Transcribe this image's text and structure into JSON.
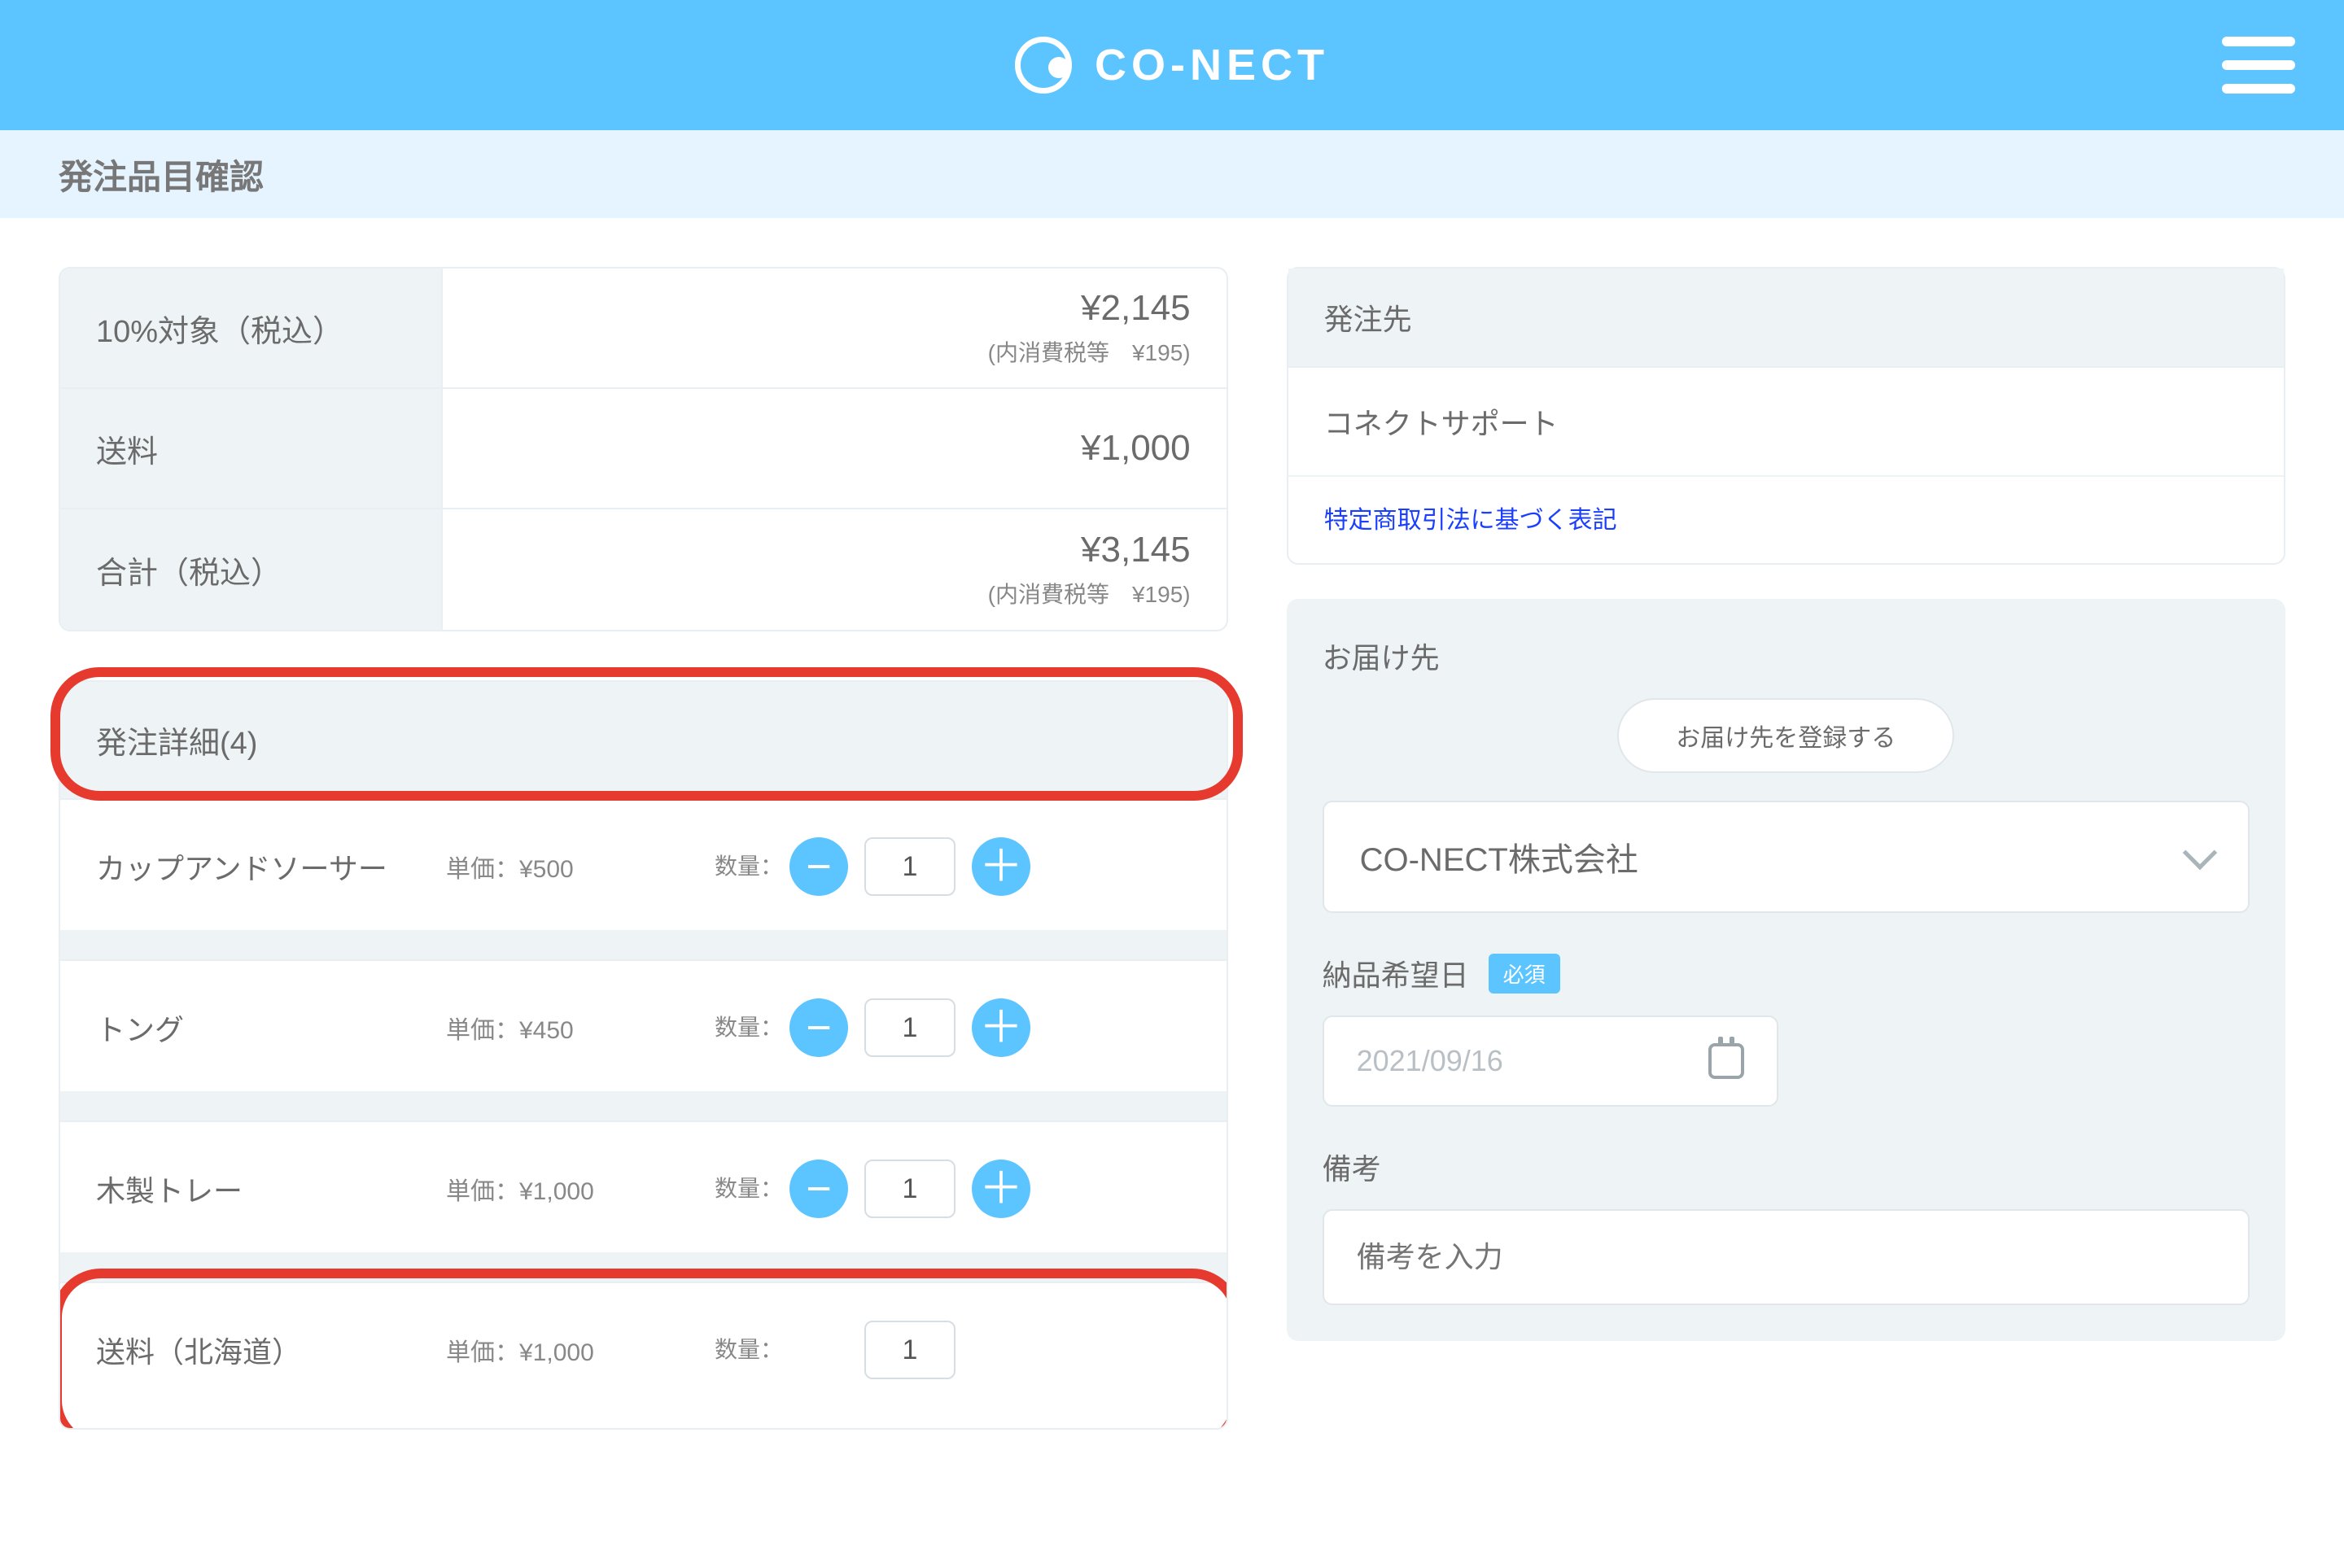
{
  "header": {
    "brand": "CO-NECT"
  },
  "subheader": {
    "title": "発注品目確認"
  },
  "summary": {
    "rows": [
      {
        "label": "10%対象（税込）",
        "amount": "¥2,145",
        "sub": "(内消費税等　¥195)"
      },
      {
        "label": "送料",
        "amount": "¥1,000",
        "sub": ""
      },
      {
        "label": "合計（税込）",
        "amount": "¥3,145",
        "sub": "(内消費税等　¥195)"
      }
    ]
  },
  "details": {
    "title": "発注詳細(4)",
    "qty_label": "数量：",
    "items": [
      {
        "name": "カップアンドソーサー",
        "unit": "単価：¥500",
        "qty": "1"
      },
      {
        "name": "トング",
        "unit": "単価：¥450",
        "qty": "1"
      },
      {
        "name": "木製トレー",
        "unit": "単価：¥1,000",
        "qty": "1"
      },
      {
        "name": "送料（北海道）",
        "unit": "単価：¥1,000",
        "qty": "1"
      }
    ]
  },
  "supplier": {
    "head": "発注先",
    "name": "コネクトサポート",
    "law_link": "特定商取引法に基づく表記"
  },
  "delivery": {
    "head": "お届け先",
    "register_btn": "お届け先を登録する",
    "selected": "CO-NECT株式会社"
  },
  "due": {
    "head": "納品希望日",
    "badge": "必須",
    "placeholder": "2021/09/16"
  },
  "remarks": {
    "head": "備考",
    "placeholder": "備考を入力"
  }
}
